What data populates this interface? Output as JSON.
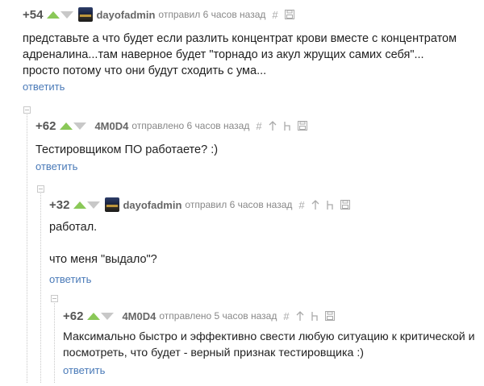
{
  "comments": [
    {
      "rating": "+54",
      "author": "dayofadmin",
      "verb": "отправил 6 часов назад",
      "has_avatar": true,
      "lines": [
        "представьте а что будет если разлить концентрат крови вместе с концентратом",
        "адреналина...там наверное будет \"торнадо из акул жрущих самих себя\"...",
        "просто потому что они будут сходить с ума..."
      ],
      "reply": "ответить"
    },
    {
      "rating": "+62",
      "author": "4M0D4",
      "verb": "отправлено 6 часов назад",
      "has_avatar": false,
      "lines": [
        "Тестировщиком ПО работаете? :)"
      ],
      "reply": "ответить"
    },
    {
      "rating": "+32",
      "author": "dayofadmin",
      "verb": "отправил 6 часов назад",
      "has_avatar": true,
      "lines": [
        "работал.",
        "",
        "что меня \"выдало\"?"
      ],
      "reply": "ответить"
    },
    {
      "rating": "+62",
      "author": "4M0D4",
      "verb": "отправлено 5 часов назад",
      "has_avatar": false,
      "lines": [
        "Максимально быстро и эффективно свести любую ситуацию к критической и",
        "посмотреть, что будет - верный признак тестировщика :)"
      ],
      "reply": "ответить"
    }
  ],
  "icons": {
    "hash": "hash-icon",
    "save": "save-icon",
    "parent": "parent-arrow-icon",
    "branch": "branch-icon",
    "collapse": "collapse-icon"
  },
  "colors": {
    "upvote": "#8ac858",
    "downvote": "#c8c8c8",
    "link": "#4a7ab8",
    "rating": "#555555",
    "meta": "#888888"
  }
}
